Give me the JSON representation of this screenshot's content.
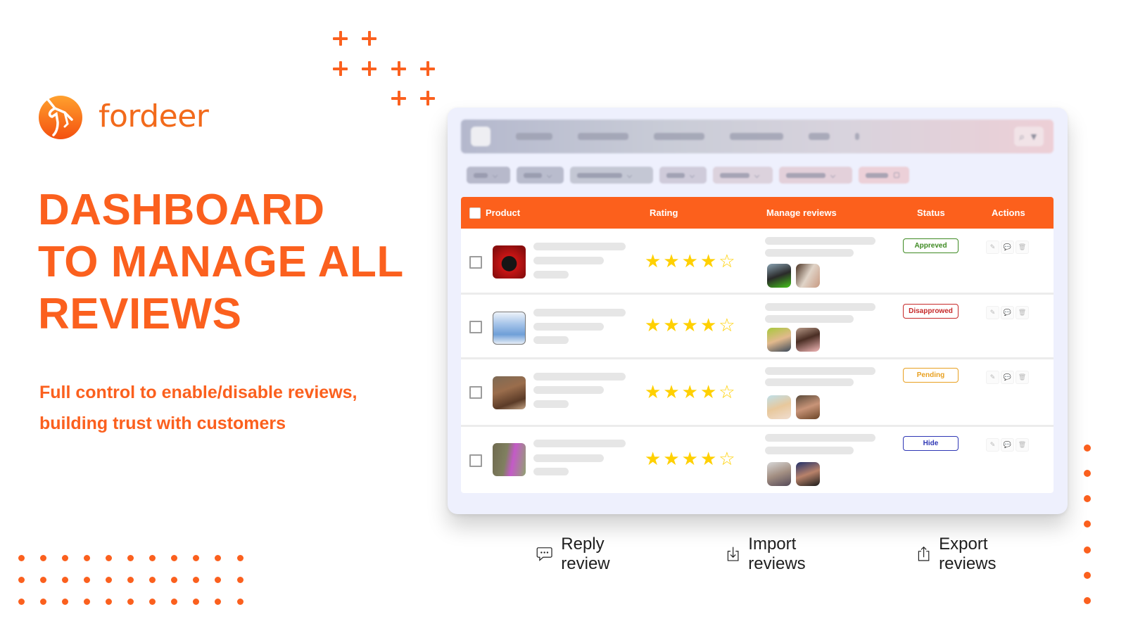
{
  "brand": {
    "name": "fordeer",
    "logo_icon": "deer-head-logo-icon",
    "accent_color": "#fb601e"
  },
  "hero": {
    "headline_lines": [
      "DASHBOARD",
      "TO MANAGE ALL",
      "REVIEWS"
    ],
    "subtitle_lines": [
      "Full control to enable/disable reviews,",
      "building trust with customers"
    ]
  },
  "dashboard": {
    "topbar_blurred": true,
    "filters_blurred": true,
    "table": {
      "header_color": "#fc601c",
      "columns": [
        "Product",
        "Rating",
        "Manage reviews",
        "Status",
        "Actions"
      ],
      "rows": [
        {
          "product_image": "black-bear-rose-gift-box",
          "rating": 4,
          "rating_max": 5,
          "reviewer_avatars": [
            "man-black-shirt",
            "couple-selfie"
          ],
          "status": "Appreved",
          "status_color": "#3e8a22"
        },
        {
          "product_image": "baby-blue-onesie",
          "rating": 4,
          "rating_max": 5,
          "reviewer_avatars": [
            "toddler-boy",
            "girl-pink-top"
          ],
          "status": "Disapprowed",
          "status_color": "#c62828"
        },
        {
          "product_image": "brown-fur-boots",
          "rating": 4,
          "rating_max": 5,
          "reviewer_avatars": [
            "blonde-woman",
            "woman-glasses"
          ],
          "status": "Pending",
          "status_color": "#e8a020"
        },
        {
          "product_image": "kids-costumes",
          "rating": 4,
          "rating_max": 5,
          "reviewer_avatars": [
            "man-city",
            "smiling-man"
          ],
          "status": "Hide",
          "status_color": "#2f37b5"
        }
      ],
      "row_actions": [
        {
          "icon": "edit-icon",
          "glyph": "✎"
        },
        {
          "icon": "reply-icon",
          "glyph": "💬"
        },
        {
          "icon": "delete-icon",
          "glyph": "🗑"
        }
      ]
    }
  },
  "features": [
    {
      "icon": "chat-bubble-icon",
      "label": "Reply review"
    },
    {
      "icon": "import-icon",
      "label": "Import reviews"
    },
    {
      "icon": "export-icon",
      "label": "Export reviews"
    }
  ]
}
